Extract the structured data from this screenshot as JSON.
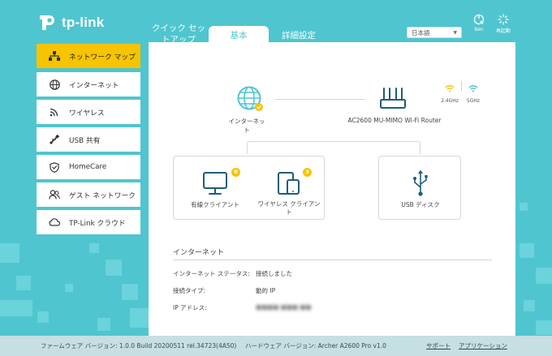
{
  "brand": {
    "logo_text": "tp-link"
  },
  "top_tabs": {
    "quick_setup": "クイック セットアップ",
    "basic": "基本",
    "advanced": "詳細設定"
  },
  "language": {
    "selected": "日本語"
  },
  "header_buttons": {
    "logout": "ben",
    "reboot": "再起動"
  },
  "sidebar": {
    "items": [
      {
        "label": "ネットワーク マップ",
        "icon": "network-map-icon",
        "active": true
      },
      {
        "label": "インターネット",
        "icon": "globe-icon"
      },
      {
        "label": "ワイヤレス",
        "icon": "wifi-icon"
      },
      {
        "label": "USB 共有",
        "icon": "usb-icon"
      },
      {
        "label": "HomeCare",
        "icon": "shield-icon"
      },
      {
        "label": "ゲスト ネットワーク",
        "icon": "guest-icon"
      },
      {
        "label": "TP-Link クラウド",
        "icon": "cloud-icon"
      }
    ]
  },
  "map": {
    "internet_label": "インターネット",
    "router_label": "AC2600 MU-MIMO Wi-Fi Router",
    "band_24": "2.4GHz",
    "band_5": "5GHz",
    "wired_clients_label": "有線クライアント",
    "wired_clients_count": "0",
    "wireless_clients_label": "ワイヤレス クライアント",
    "wireless_clients_count": "3",
    "usb_label": "USB ディスク"
  },
  "internet_info": {
    "title": "インターネット",
    "status_label": "インターネット ステータス:",
    "status_value": "接続しました",
    "conn_type_label": "接続タイプ:",
    "conn_type_value": "動的 IP",
    "ip_label": "IP アドレス:",
    "ip_value": "■■■■.■■■.■■"
  },
  "footer": {
    "firmware": "ファームウェア バージョン: 1.0.0 Build 20200511 rel.34723(4A50)",
    "hardware": "ハードウェア バージョン: Archer A2600 Pro v1.0",
    "support": "サポート",
    "app": "アプリケーション"
  },
  "colors": {
    "accent": "#4fc5cf",
    "active": "#f6c400",
    "footer": "#c6dfe3"
  }
}
